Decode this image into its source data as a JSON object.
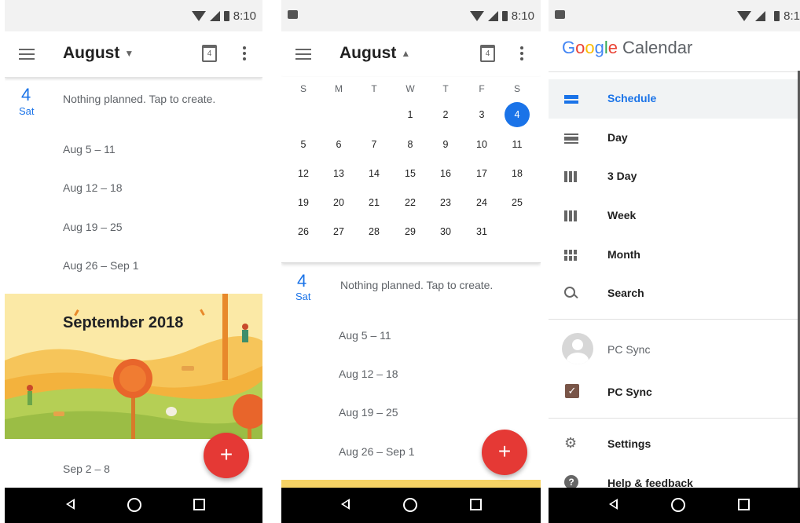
{
  "status": {
    "time": "8:10",
    "time_clipped": "8:1"
  },
  "schedule_view": {
    "month": "August",
    "today_icon_day": "4",
    "today": {
      "day_number": "4",
      "day_name": "Sat",
      "message": "Nothing planned. Tap to create."
    },
    "week_ranges": [
      "Aug 5 – 11",
      "Aug 12 – 18",
      "Aug 19 – 25",
      "Aug 26 – Sep 1"
    ],
    "month_banner": "September 2018",
    "next_range": "Sep 2 – 8",
    "fab_label": "+"
  },
  "month_picker_view": {
    "month": "August",
    "today_icon_day": "4",
    "weekday_headers": [
      "S",
      "M",
      "T",
      "W",
      "T",
      "F",
      "S"
    ],
    "weeks": [
      [
        "",
        "",
        "",
        "1",
        "2",
        "3",
        "4"
      ],
      [
        "5",
        "6",
        "7",
        "8",
        "9",
        "10",
        "11"
      ],
      [
        "12",
        "13",
        "14",
        "15",
        "16",
        "17",
        "18"
      ],
      [
        "19",
        "20",
        "21",
        "22",
        "23",
        "24",
        "25"
      ],
      [
        "26",
        "27",
        "28",
        "29",
        "30",
        "31",
        ""
      ]
    ],
    "selected_day": "4",
    "today": {
      "day_number": "4",
      "day_name": "Sat",
      "message": "Nothing planned. Tap to create."
    },
    "week_ranges": [
      "Aug 5 – 11",
      "Aug 12 – 18",
      "Aug 19 – 25",
      "Aug 26 – Sep 1"
    ],
    "fab_label": "+"
  },
  "drawer": {
    "logo_google": [
      "G",
      "o",
      "o",
      "g",
      "l",
      "e"
    ],
    "logo_word": "Calendar",
    "views": [
      {
        "label": "Schedule",
        "icon": "schedule-icon",
        "active": true
      },
      {
        "label": "Day",
        "icon": "day-icon",
        "active": false
      },
      {
        "label": "3 Day",
        "icon": "three-day-icon",
        "active": false
      },
      {
        "label": "Week",
        "icon": "week-icon",
        "active": false
      },
      {
        "label": "Month",
        "icon": "month-icon",
        "active": false
      },
      {
        "label": "Search",
        "icon": "search-icon",
        "active": false
      }
    ],
    "account_name": "PC Sync",
    "calendar_name": "PC Sync",
    "settings_label": "Settings",
    "help_label": "Help & feedback"
  },
  "colors": {
    "accent": "#1a73e8",
    "fab": "#e53935",
    "checkbox": "#795548"
  }
}
